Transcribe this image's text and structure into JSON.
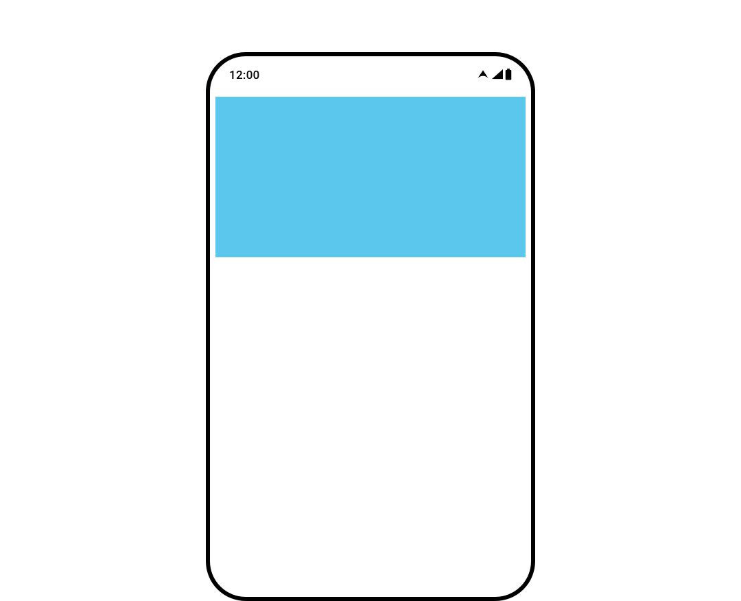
{
  "status_bar": {
    "time": "12:00",
    "icons": {
      "wifi": "wifi-icon",
      "signal": "signal-icon",
      "battery": "battery-icon"
    }
  },
  "content": {
    "banner": {
      "color": "#5bc7ec"
    }
  }
}
